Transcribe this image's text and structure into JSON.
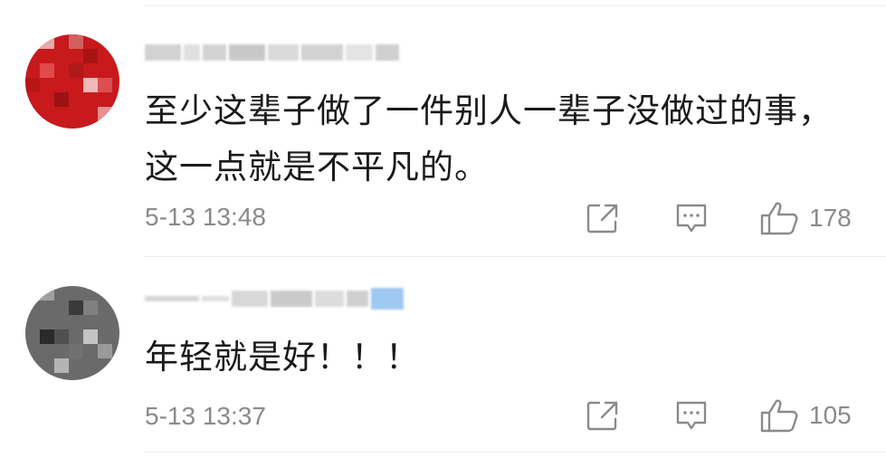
{
  "comments": [
    {
      "text": "至少这辈子做了一件别人一辈子没做过的事，\n这一点就是不平凡的。",
      "timestamp": "5-13 13:48",
      "likes": "178"
    },
    {
      "text": "年轻就是好！！！",
      "timestamp": "5-13 13:37",
      "likes": "105"
    }
  ],
  "icons": {
    "share": "share-icon",
    "reply": "comment-icon",
    "like": "thumbs-up-icon"
  },
  "colors": {
    "text": "#1a1a1a",
    "meta": "#8a8a8a",
    "divider": "#ececec",
    "avatar1": "#c0191c",
    "avatar2": "#5a5a5a",
    "badge": "#7fb8f0"
  }
}
